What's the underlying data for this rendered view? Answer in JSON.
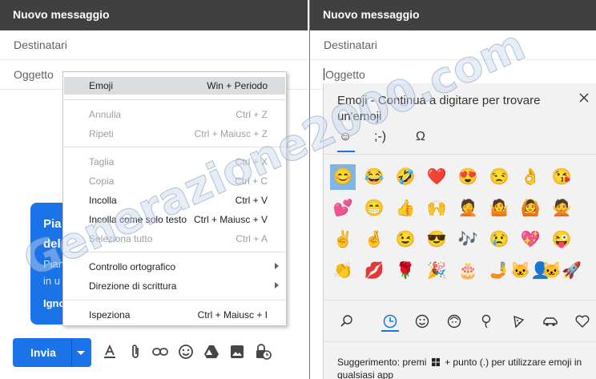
{
  "left": {
    "title": "Nuovo messaggio",
    "to_placeholder": "Destinatari",
    "subject_placeholder": "Oggetto",
    "bubble": {
      "line1": "Pia",
      "line2": "del",
      "line3": "Pian",
      "line4": "in u",
      "line5": "Igno"
    },
    "menu": [
      {
        "label": "Emoji",
        "shortcut": "Win + Periodo"
      },
      {
        "label": "Annulla",
        "shortcut": "Ctrl + Z"
      },
      {
        "label": "Ripeti",
        "shortcut": "Ctrl + Maiusc + Z"
      },
      {
        "label": "Taglia",
        "shortcut": "Ctrl + X"
      },
      {
        "label": "Copia",
        "shortcut": "Ctrl + C"
      },
      {
        "label": "Incolla",
        "shortcut": "Ctrl + V"
      },
      {
        "label": "Incolla come solo testo",
        "shortcut": "Ctrl + Maiusc + V"
      },
      {
        "label": "Seleziona tutto",
        "shortcut": "Ctrl + A"
      },
      {
        "label": "Controllo ortografico",
        "shortcut": ""
      },
      {
        "label": "Direzione di scrittura",
        "shortcut": ""
      },
      {
        "label": "Ispeziona",
        "shortcut": "Ctrl + Maiusc + I"
      }
    ],
    "send_label": "Invia",
    "toolbar_icons": [
      "format-text-icon",
      "attach-icon",
      "link-icon",
      "emoji-icon",
      "drive-icon",
      "photo-icon",
      "schedule-lock-icon"
    ]
  },
  "right": {
    "title": "Nuovo messaggio",
    "to_placeholder": "Destinatari",
    "subject_placeholder": "Oggetto",
    "picker": {
      "title": "Emoji - Continua a digitare per trovare un'emoji",
      "tabs": [
        "☺",
        ";-)",
        "Ω"
      ],
      "emojis": [
        "😊",
        "😂",
        "🤣",
        "❤️",
        "😍",
        "😒",
        "👌",
        "😘",
        "💕",
        "😁",
        "👍",
        "🙌",
        "🤦",
        "🤷",
        "🙆",
        "🙅",
        "✌️",
        "🤞",
        "😉",
        "😎",
        "🎶",
        "😢",
        "💖",
        "😜",
        "👏",
        "💋",
        "🌹",
        "🎉",
        "🎂",
        "🤳",
        "🐱‍👤",
        "🐱‍🚀"
      ],
      "hint_prefix": "Suggerimento: premi",
      "hint_suffix": "+ punto (.) per utilizzare emoji in qualsiasi app"
    }
  },
  "watermark": "Generazione2000.com",
  "colors": {
    "header_bg": "#404040",
    "accent": "#1a73e8",
    "picker_bg": "#f2f2f2",
    "selected_emoji_bg": "#7fb6e8"
  }
}
